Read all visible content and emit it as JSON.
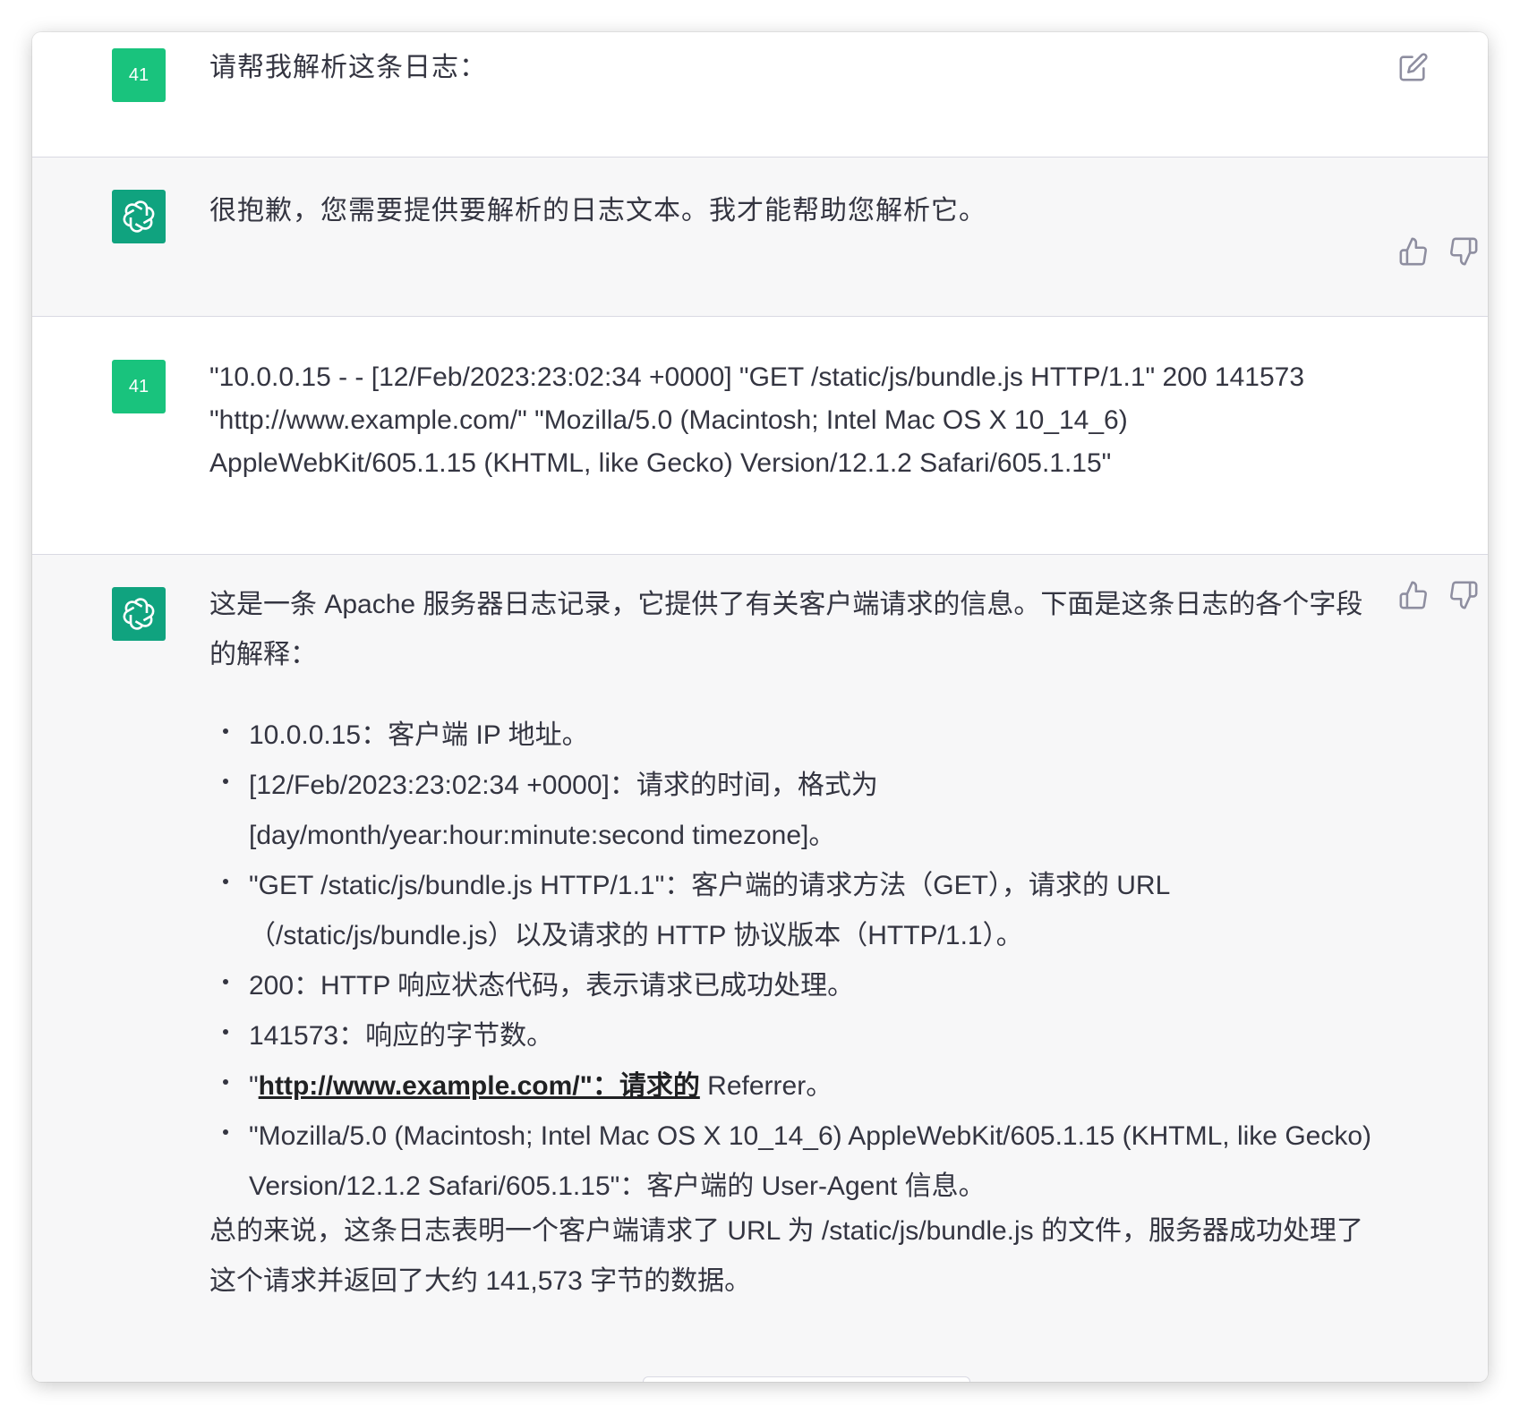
{
  "conversation": {
    "messages": [
      {
        "role": "user",
        "avatar_label": "41",
        "text": "请帮我解析这条日志："
      },
      {
        "role": "assistant",
        "text": "很抱歉，您需要提供要解析的日志文本。我才能帮助您解析它。"
      },
      {
        "role": "user",
        "avatar_label": "41",
        "text": "\"10.0.0.15 - - [12/Feb/2023:23:02:34 +0000] \"GET /static/js/bundle.js HTTP/1.1\" 200 141573 \"http://www.example.com/\" \"Mozilla/5.0 (Macintosh; Intel Mac OS X 10_14_6) AppleWebKit/605.1.15 (KHTML, like Gecko) Version/12.1.2 Safari/605.1.15\""
      },
      {
        "role": "assistant",
        "intro": "这是一条 Apache 服务器日志记录，它提供了有关客户端请求的信息。下面是这条日志的各个字段的解释：",
        "bullets": [
          "10.0.0.15：客户端 IP 地址。",
          "[12/Feb/2023:23:02:34 +0000]：请求的时间，格式为 [day/month/year:hour:minute:second timezone]。",
          "\"GET /static/js/bundle.js HTTP/1.1\"：客户端的请求方法（GET），请求的 URL（/static/js/bundle.js）以及请求的 HTTP 协议版本（HTTP/1.1）。",
          "200：HTTP 响应状态代码，表示请求已成功处理。",
          "141573：响应的字节数。",
          "\"",
          "\"Mozilla/5.0 (Macintosh; Intel Mac OS X 10_14_6) AppleWebKit/605.1.15 (KHTML, like Gecko) Version/12.1.2 Safari/605.1.15\"：客户端的 User-Agent 信息。"
        ],
        "referrer_bullet": {
          "quote_prefix": "\"",
          "link_text": "http://www.example.com/\"：请求的",
          "suffix": " Referrer。"
        },
        "summary": "总的来说，这条日志表明一个客户端请求了 URL 为 /static/js/bundle.js 的文件，服务器成功处理了这个请求并返回了大约 141,573 字节的数据。"
      }
    ]
  },
  "icons": {
    "edit": "edit-icon",
    "thumbs_up": "thumbs-up-icon",
    "thumbs_down": "thumbs-down-icon",
    "assistant_logo": "openai-logo-icon"
  },
  "colors": {
    "user_avatar": "#19c37d",
    "assistant_avatar": "#10a37f",
    "assistant_bg": "#f7f7f8",
    "divider": "#d9d9e3",
    "text": "#343541",
    "icon": "#8e8ea0"
  }
}
